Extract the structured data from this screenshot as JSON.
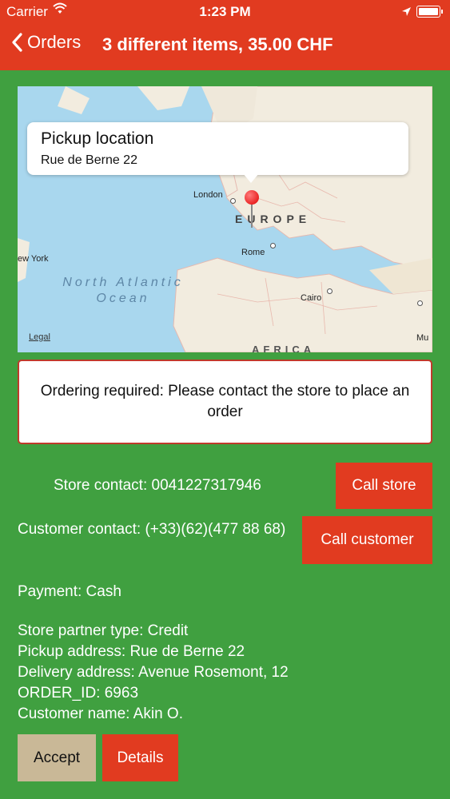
{
  "status_bar": {
    "carrier": "Carrier",
    "time": "1:23 PM"
  },
  "nav": {
    "back_label": "Orders",
    "title": "3 different items, 35.00 CHF"
  },
  "map": {
    "callout_title": "Pickup location",
    "callout_subtitle": "Rue de Berne 22",
    "labels": {
      "london": "London",
      "europe": "EUROPE",
      "new_york": "ew York",
      "rome": "Rome",
      "ocean": "North Atlantic Ocean",
      "cairo": "Cairo",
      "mu": "Mu",
      "africa": "AFRICA",
      "legal": "Legal"
    }
  },
  "notice": "Ordering required: Please contact the store to place an order",
  "store_contact": "Store contact: 0041227317946",
  "call_store_label": "Call store",
  "customer_contact": "Customer contact: (+33)(62)(477 88 68)",
  "call_customer_label": "Call customer",
  "payment": "Payment: Cash",
  "details": {
    "partner_type": "Store partner type: Credit",
    "pickup_address": "Pickup address: Rue de Berne 22",
    "delivery_address": "Delivery address: Avenue Rosemont, 12",
    "order_id": "ORDER_ID: 6963",
    "customer_name": "Customer name: Akin O."
  },
  "accept_label": "Accept",
  "details_label": "Details",
  "colors": {
    "accent": "#e13b20",
    "background": "#40a040",
    "accept": "#c9b897"
  }
}
